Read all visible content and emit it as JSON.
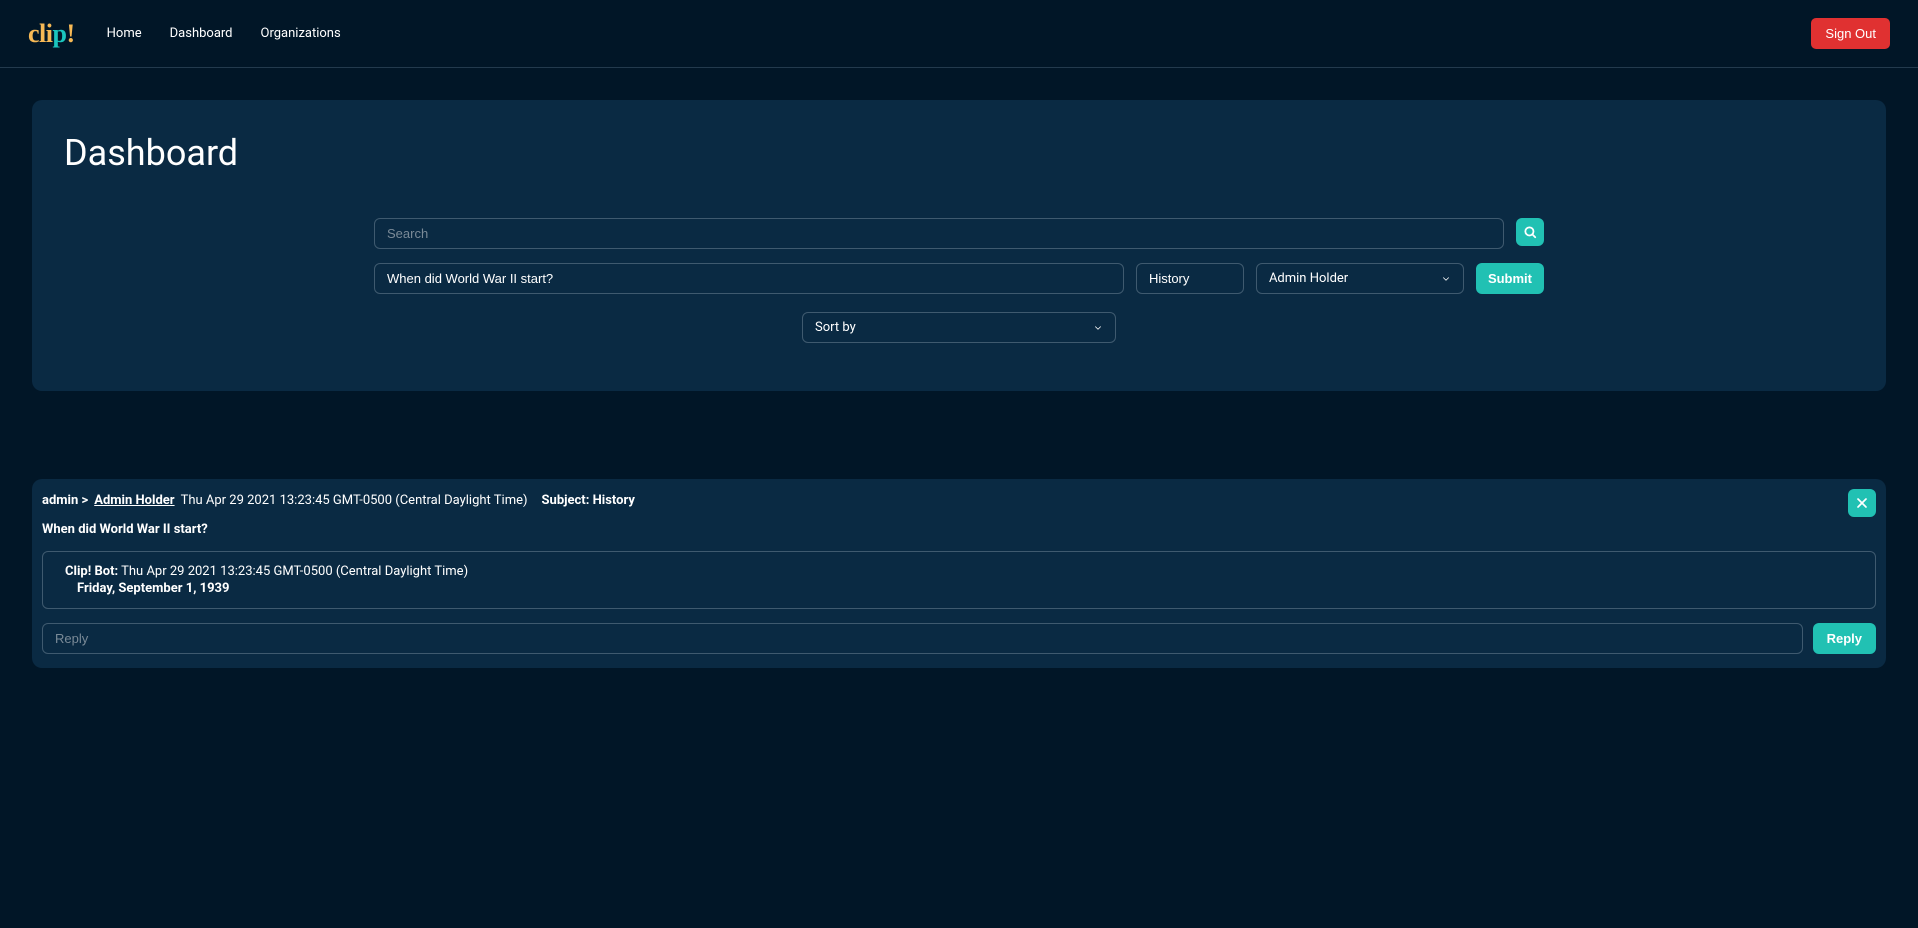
{
  "navbar": {
    "logo": "clip!",
    "links": {
      "home": "Home",
      "dashboard": "Dashboard",
      "organizations": "Organizations"
    },
    "sign_out": "Sign Out"
  },
  "page": {
    "title": "Dashboard"
  },
  "search": {
    "placeholder": "Search"
  },
  "query": {
    "question_value": "When did World War II start?",
    "subject_value": "History",
    "user_selected": "Admin Holder",
    "submit_label": "Submit"
  },
  "sort": {
    "label": "Sort by"
  },
  "thread": {
    "user_prefix": "admin >",
    "user_link": "Admin Holder",
    "timestamp": "Thu Apr 29 2021 13:23:45 GMT-0500 (Central Daylight Time)",
    "subject_label": "Subject: History",
    "question": "When did World War II start?",
    "bot": {
      "name": "Clip! Bot:",
      "timestamp": "Thu Apr 29 2021 13:23:45 GMT-0500 (Central Daylight Time)",
      "answer": "Friday, September 1, 1939"
    },
    "reply_placeholder": "Reply",
    "reply_button": "Reply"
  }
}
